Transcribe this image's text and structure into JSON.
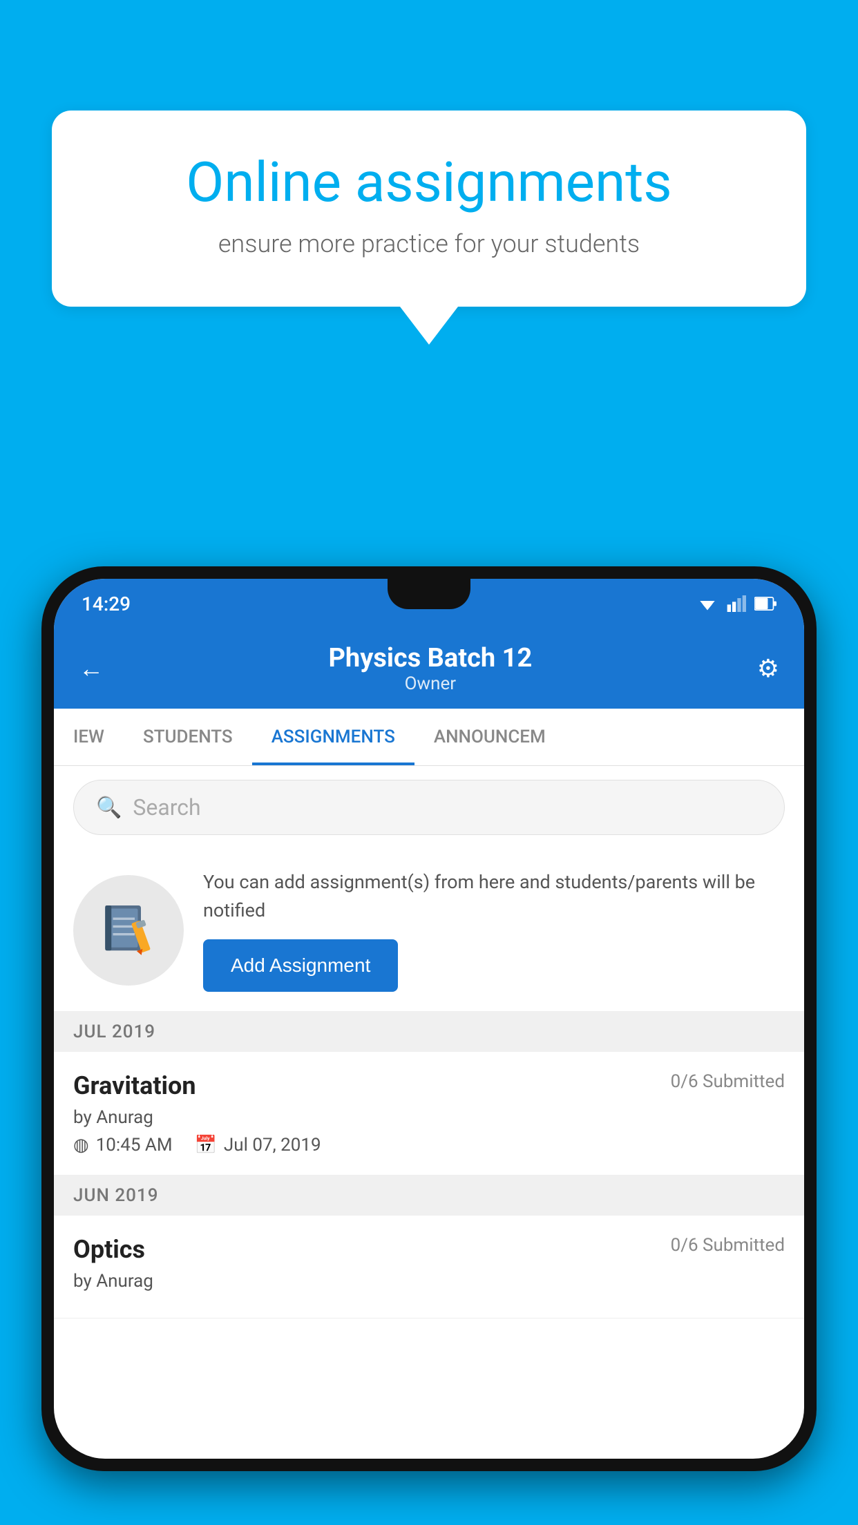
{
  "background": {
    "color": "#00AEEF"
  },
  "speech_bubble": {
    "title": "Online assignments",
    "subtitle": "ensure more practice for your students"
  },
  "phone": {
    "status_bar": {
      "time": "14:29"
    },
    "header": {
      "title": "Physics Batch 12",
      "subtitle": "Owner"
    },
    "tabs": [
      {
        "label": "IEW",
        "active": false
      },
      {
        "label": "STUDENTS",
        "active": false
      },
      {
        "label": "ASSIGNMENTS",
        "active": true
      },
      {
        "label": "ANNOUNCEM",
        "active": false
      }
    ],
    "search": {
      "placeholder": "Search"
    },
    "add_assignment_card": {
      "description": "You can add assignment(s) from here and students/parents will be notified",
      "button_label": "Add Assignment"
    },
    "assignment_groups": [
      {
        "month": "JUL 2019",
        "assignments": [
          {
            "name": "Gravitation",
            "submitted": "0/6 Submitted",
            "by": "by Anurag",
            "time": "10:45 AM",
            "date": "Jul 07, 2019"
          }
        ]
      },
      {
        "month": "JUN 2019",
        "assignments": [
          {
            "name": "Optics",
            "submitted": "0/6 Submitted",
            "by": "by Anurag",
            "time": "",
            "date": ""
          }
        ]
      }
    ]
  }
}
